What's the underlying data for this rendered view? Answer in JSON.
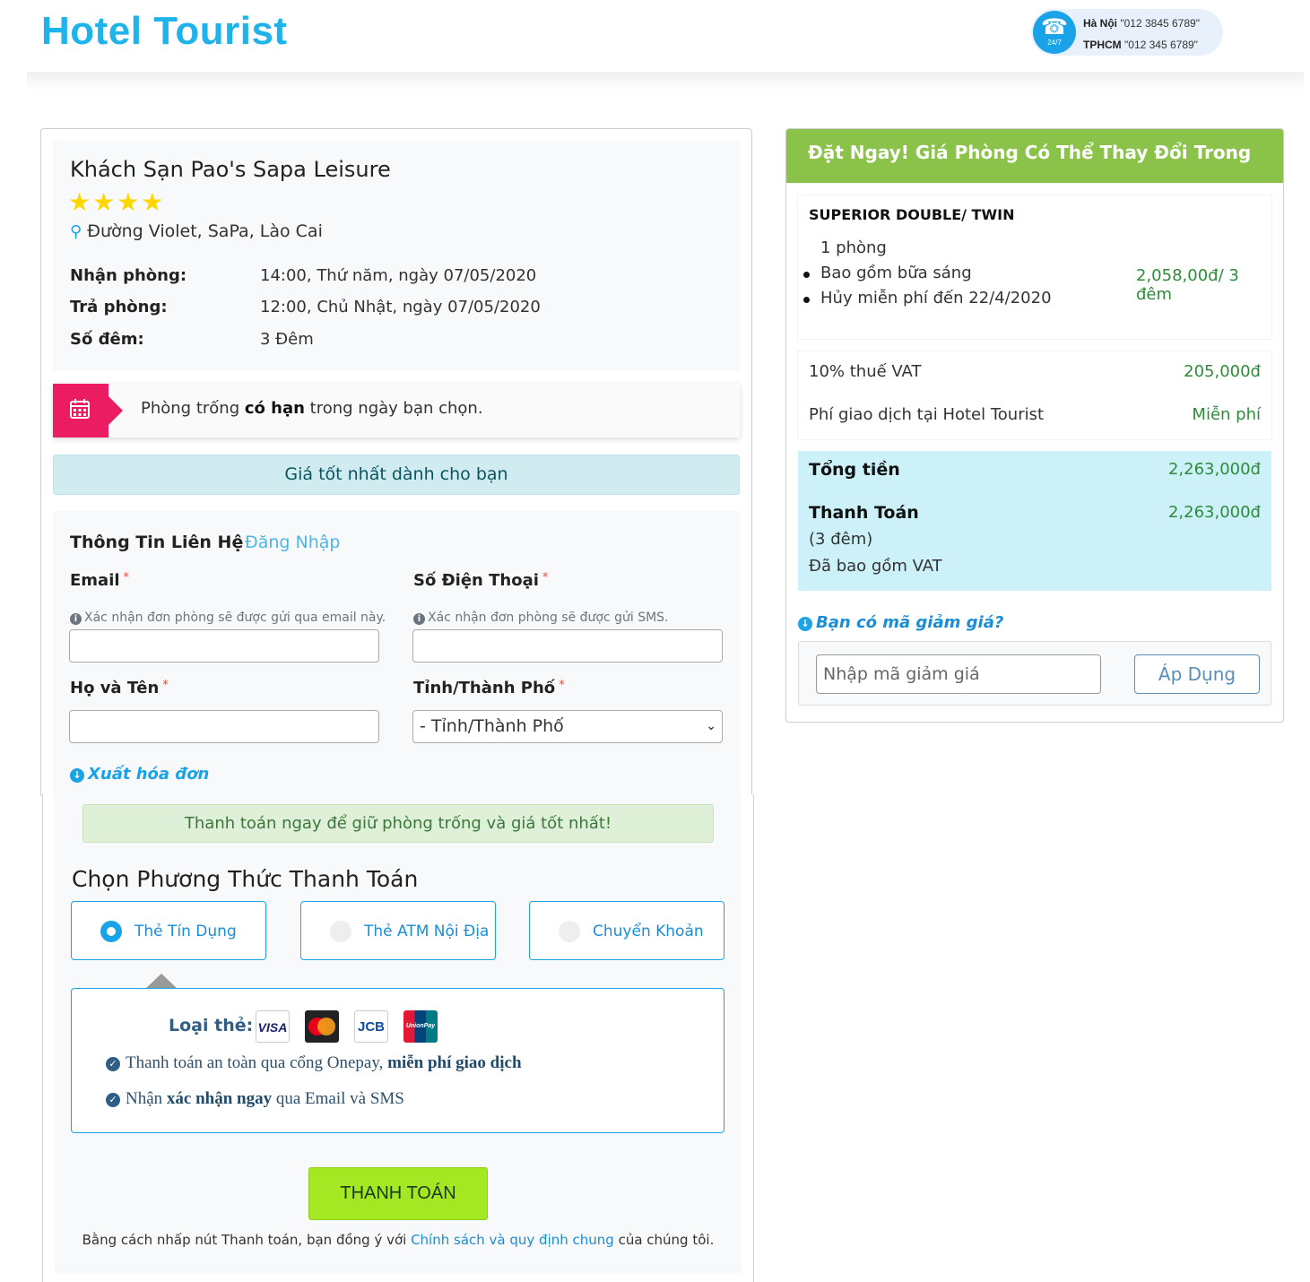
{
  "header": {
    "brand": "Hotel Tourist",
    "hotline_badge": "24/7",
    "hotlines": [
      {
        "city": "Hà Nội",
        "phone": "\"012 3845 6789\""
      },
      {
        "city": "TPHCM",
        "phone": "\"012 345 6789\""
      }
    ]
  },
  "hotel": {
    "name": "Khách Sạn Pao's Sapa Leisure",
    "stars": "★★★★",
    "address": "Đường Violet, SaPa, Lào Cai",
    "checkin_label": "Nhận phòng:",
    "checkin_value": "14:00, Thứ năm, ngày 07/05/2020",
    "checkout_label": "Trả phòng:",
    "checkout_value": "12:00, Chủ Nhật, ngày 07/05/2020",
    "nights_label": "Số đêm:",
    "nights_value": "3 Đêm"
  },
  "notice": {
    "prefix": "Phòng trống ",
    "bold": "có hạn",
    "suffix": " trong ngày bạn chọn."
  },
  "best_price": "Giá tốt nhất dành cho bạn",
  "contact": {
    "title": "Thông Tin Liên Hệ",
    "login": "Đăng Nhập",
    "email_label": "Email",
    "email_hint": "Xác nhận đơn phòng sẽ được gửi qua email này.",
    "phone_label": "Số Điện Thoại",
    "phone_hint": "Xác nhận đơn phòng sẽ được gửi SMS.",
    "name_label": "Họ và Tên",
    "city_label": "Tỉnh/Thành Phố",
    "city_selected": "- Tỉnh/Thành Phố",
    "required_mark": "*",
    "invoice": "Xuất hóa đơn"
  },
  "payment": {
    "pay_now": "Thanh toán ngay để giữ phòng trống và giá tốt nhất!",
    "title": "Chọn Phương Thức Thanh Toán",
    "options": [
      {
        "label": "Thẻ Tín Dụng",
        "selected": true
      },
      {
        "label": "Thẻ ATM Nội Địa",
        "selected": false
      },
      {
        "label": "Chuyển Khoản",
        "selected": false
      }
    ],
    "card_type_label": "Loại thẻ:",
    "cards": [
      "VISA",
      "MasterCard",
      "JCB",
      "UnionPay"
    ],
    "line1_prefix": "Thanh toán an toàn qua cổng Onepay, ",
    "line1_bold": "miễn phí giao dịch",
    "line2_prefix": "Nhận ",
    "line2_bold": "xác nhận ngay",
    "line2_suffix": " qua Email và SMS",
    "button": "THANH TOÁN",
    "terms_prefix": "Bằng cách nhấp nút Thanh toán, bạn đồng ý với ",
    "terms_link": "Chính sách và quy định chung",
    "terms_suffix": " của chúng tôi."
  },
  "summary": {
    "header": "Đặt Ngay! Giá Phòng Có Thể Thay Đổi Trong Giây Lát!",
    "room_type": "SUPERIOR DOUBLE/ TWIN",
    "room_count": "1 phòng",
    "breakfast": "Bao gồm bữa sáng",
    "cancel": "Hủy miễn phí đến 22/4/2020",
    "room_price": "2,058,00đ/ 3 đêm",
    "vat_label": "10% thuế VAT",
    "vat_value": "205,000đ",
    "fee_label": "Phí giao dịch tại Hotel Tourist",
    "fee_value": "Miễn phí",
    "total_label": "Tổng tiền",
    "total_value": "2,263,000đ",
    "pay_label": "Thanh Toán",
    "pay_value": "2,263,000đ",
    "pay_nights": "(3 đêm)",
    "vat_included": "Đã bao gồm VAT",
    "coupon_link": "Bạn có mã giảm giá?",
    "coupon_placeholder": "Nhập mã giảm giá",
    "coupon_button": "Áp Dụng"
  },
  "colors": {
    "brand": "#1fb3ec",
    "accent": "#1aa3e8",
    "green_header": "#8bc34a",
    "pay_button": "#a4e823",
    "notice_flag": "#ec1c63"
  }
}
